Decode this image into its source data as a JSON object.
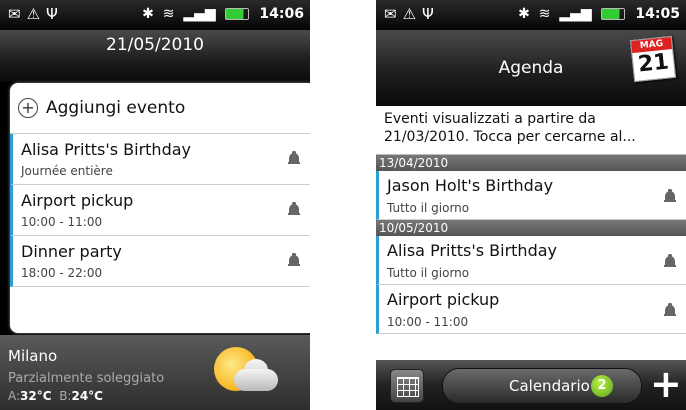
{
  "status_bar": {
    "time": "14:06"
  },
  "status_bar_right": {
    "time": "14:05"
  },
  "left_screen": {
    "date_title": "21/05/2010",
    "add_event_label": "Aggiungi evento",
    "events": [
      {
        "title": "Alisa Pritts's Birthday",
        "subtitle": "Journée entière"
      },
      {
        "title": "Airport pickup",
        "subtitle": "10:00 - 11:00"
      },
      {
        "title": "Dinner party",
        "subtitle": "18:00 - 22:00"
      }
    ],
    "weather": {
      "city": "Milano",
      "description": "Parzialmente soleggiato",
      "high_label": "A:",
      "high_value": "32°C",
      "low_label": "B:",
      "low_value": "24°C"
    }
  },
  "right_screen": {
    "title": "Agenda",
    "calendar_icon": {
      "month": "MAG",
      "day": "21"
    },
    "notice_line1": "Eventi visualizzati a partire da",
    "notice_line2": "21/03/2010. Tocca per cercarne al...",
    "groups": [
      {
        "date": "13/04/2010",
        "events": [
          {
            "title": "Jason Holt's Birthday",
            "subtitle": "Tutto il giorno"
          }
        ]
      },
      {
        "date": "10/05/2010",
        "events": [
          {
            "title": "Alisa Pritts's Birthday",
            "subtitle": "Tutto il giorno"
          },
          {
            "title": "Airport pickup",
            "subtitle": "10:00 - 11:00"
          }
        ]
      }
    ],
    "bottom_bar": {
      "calendar_label": "Calendario",
      "badge_count": "2",
      "add_symbol": "+"
    }
  },
  "colors": {
    "event_accent": "#2b9ed6",
    "badge_green": "#5fa817",
    "calendar_red": "#dd2222"
  },
  "icons": [
    "envelope-icon",
    "warning-icon",
    "usb-icon",
    "bluetooth-icon",
    "wifi-icon",
    "signal-icon",
    "battery-icon",
    "bell-icon",
    "plus-icon",
    "weather-partly-sunny-icon",
    "calendar-icon",
    "calendar-grid-icon"
  ]
}
